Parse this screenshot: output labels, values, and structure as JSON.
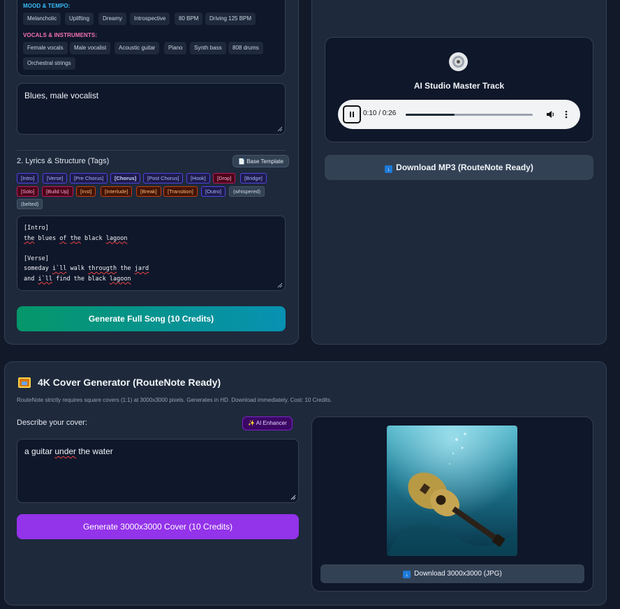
{
  "style_box": {
    "mood_label": "MOOD & TEMPO:",
    "mood_chips": [
      "Melancholic",
      "Uplifting",
      "Dreamy",
      "Introspective",
      "80 BPM",
      "Driving 125 BPM"
    ],
    "vocals_label": "VOCALS & INSTRUMENTS:",
    "vocal_chips": [
      "Female vocals",
      "Male vocalist",
      "Acoustic guitar",
      "Piano",
      "Synth bass",
      "808 drums",
      "Orchestral strings"
    ]
  },
  "style_input": {
    "value": "Blues, male vocalist"
  },
  "lyrics_section": {
    "heading": "2. Lyrics & Structure (Tags)",
    "base_template_label": "Base Template",
    "tags": [
      "[Intro]",
      "[Verse]",
      "[Pre Chorus]",
      "[Chorus]",
      "[Post Chorus]",
      "[Hook]",
      "[Drop]",
      "[Bridge]",
      "[Solo]",
      "[Build Up]",
      "[Inst]",
      "[Interlude]",
      "[Break]",
      "[Transition]",
      "[Outro]",
      "(whispered)",
      "(belted)"
    ],
    "lyrics": {
      "line1": "[Intro]",
      "line2": "the blues of the black lagoon",
      "line3": "[Verse]",
      "line4": "someday i`ll walk througth the jard",
      "line5": "and i`ll find the black lagoon"
    },
    "generate_label": "Generate Full Song (10 Credits)"
  },
  "player": {
    "title": "AI Studio Master Track",
    "time": "0:10 / 0:26",
    "progress": 0.385,
    "download_label": "Download MP3 (RouteNote Ready)"
  },
  "cover": {
    "title": "4K Cover Generator (RouteNote Ready)",
    "description": "RouteNote strictly requires square covers (1:1) at 3000x3000 pixels. Generates in HD. Download immediately. Cost: 10 Credits.",
    "describe_label": "Describe your cover:",
    "ai_enhancer_label": "AI Enhancer",
    "prompt_value": "a guitar under the water",
    "generate_label": "Generate 3000x3000 Cover (10 Credits)",
    "download_label": "Download 3000x3000 (JPG)"
  },
  "colors": {
    "mood_label": "#38bdf8",
    "vocals_label": "#f472b6",
    "generate_song_start": "#059669",
    "generate_song_end": "#0891b2",
    "generate_cover": "#9333ea"
  }
}
